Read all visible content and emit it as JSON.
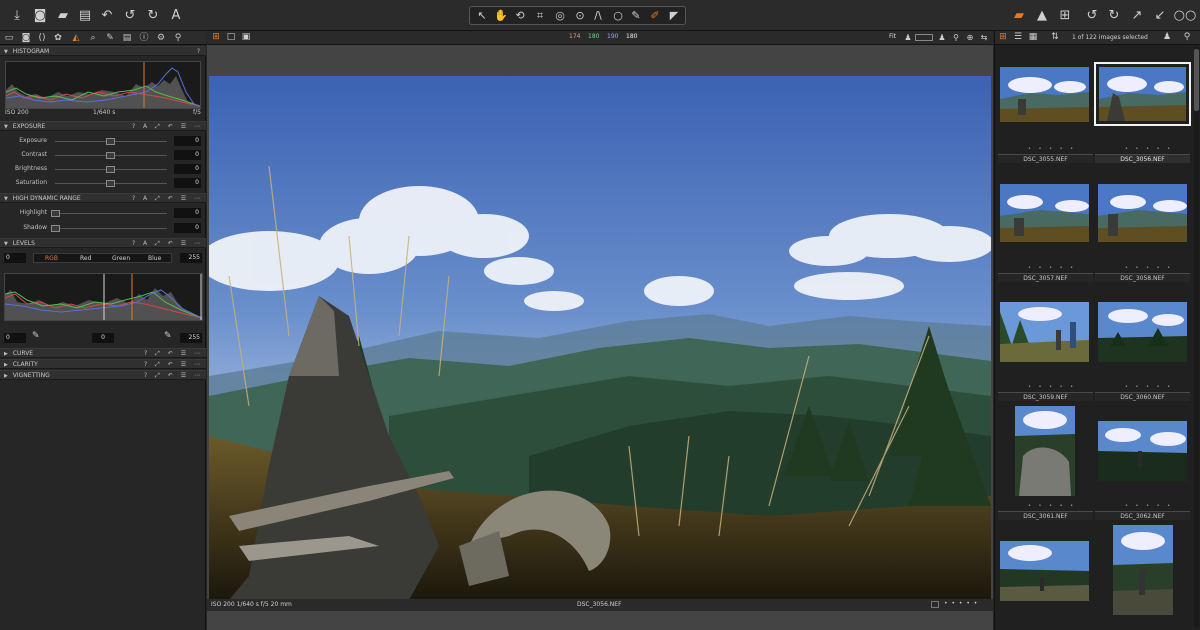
{
  "toolbar": {
    "left_icons": [
      "import-icon",
      "camera-icon",
      "folder-icon",
      "trash-icon",
      "undo-all-icon",
      "undo-icon",
      "redo-icon",
      "text-icon"
    ],
    "cursor_tools": [
      "pointer-icon",
      "pan-icon",
      "rotate-icon",
      "crop-icon",
      "keystone-icon",
      "spot-icon",
      "line-icon",
      "circle-icon",
      "brush-icon",
      "eraser-icon",
      "gradient-icon"
    ],
    "right_icons": [
      "stack-icon",
      "warning-icon",
      "grid-icon",
      "rotate-left-icon",
      "rotate-right-icon",
      "arrow-up-icon",
      "arrow-down-icon",
      "glasses-icon"
    ],
    "accent_color": "#e07b2c"
  },
  "tool_tabs": [
    "library-icon",
    "capture-icon",
    "lens-icon",
    "color-icon",
    "exposure-icon",
    "details-icon",
    "local-icon",
    "metadata-icon",
    "info-icon",
    "output-icon",
    "adjust-icon"
  ],
  "histogram": {
    "title": "HISTOGRAM",
    "iso": "ISO 200",
    "shutter": "1/640 s",
    "aperture": "f/5"
  },
  "exposure": {
    "title": "EXPOSURE",
    "sliders": [
      {
        "label": "Exposure",
        "value": "0"
      },
      {
        "label": "Contrast",
        "value": "0"
      },
      {
        "label": "Brightness",
        "value": "0"
      },
      {
        "label": "Saturation",
        "value": "0"
      }
    ]
  },
  "hdr": {
    "title": "HIGH DYNAMIC RANGE",
    "sliders": [
      {
        "label": "Highlight",
        "value": "0"
      },
      {
        "label": "Shadow",
        "value": "0"
      }
    ]
  },
  "levels": {
    "title": "LEVELS",
    "input_low": "0",
    "input_high": "255",
    "channels": [
      "RGB",
      "Red",
      "Green",
      "Blue"
    ],
    "active_channel": "RGB",
    "output_low": "0",
    "midpoint": "0",
    "output_high": "255"
  },
  "collapsed_sections": [
    "CURVE",
    "CLARITY",
    "VIGNETTING"
  ],
  "viewer": {
    "readout": [
      "174",
      "180",
      "190",
      "180"
    ],
    "fit_label": "Fit",
    "footer_exif": "ISO 200  1/640 s  f/5  20 mm",
    "footer_filename": "DSC_3056.NEF",
    "rating_dots": "• • • • •"
  },
  "browser": {
    "status": "1 of 122 images selected",
    "thumbnails": [
      {
        "name": "DSC_3055.NEF",
        "selected": false
      },
      {
        "name": "DSC_3056.NEF",
        "selected": true
      },
      {
        "name": "DSC_3057.NEF",
        "selected": false
      },
      {
        "name": "DSC_3058.NEF",
        "selected": false
      },
      {
        "name": "DSC_3059.NEF",
        "selected": false
      },
      {
        "name": "DSC_3060.NEF",
        "selected": false
      },
      {
        "name": "DSC_3061.NEF",
        "selected": false
      },
      {
        "name": "DSC_3062.NEF",
        "selected": false
      },
      {
        "name": "",
        "selected": false
      },
      {
        "name": "",
        "selected": false
      }
    ],
    "rating_dots": "• • • • •"
  }
}
